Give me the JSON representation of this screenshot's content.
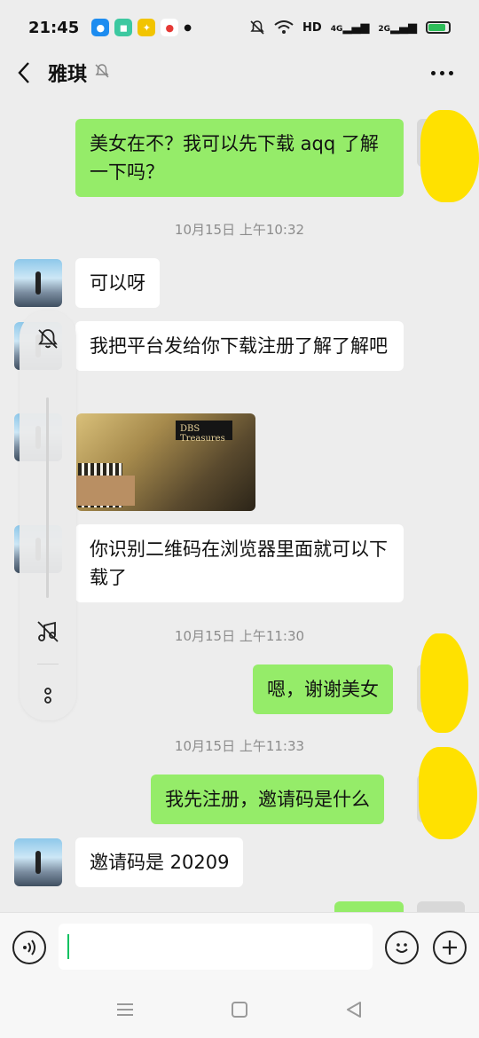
{
  "status_bar": {
    "time": "21:45",
    "network": "HD",
    "signal_1": "4G",
    "signal_2": "2G",
    "icons": [
      "qq-icon",
      "app-icon",
      "fuel-icon",
      "map-pin-icon",
      "dot-icon",
      "mute-icon",
      "wifi-icon",
      "battery-icon"
    ]
  },
  "header": {
    "title": "雅琪",
    "back_icon": "chevron-left-icon",
    "mute_icon": "bell-off-icon",
    "more_icon": "more-dots-icon"
  },
  "messages": [
    {
      "sender": "me",
      "text": "美女在不？我可以先下载 aqq 了解一下吗？"
    },
    {
      "type": "time",
      "text": "10月15日 上午10:32"
    },
    {
      "sender": "them",
      "text": "可以呀"
    },
    {
      "sender": "them",
      "text": "我把平台发给你下载注册了解了解吧"
    },
    {
      "sender": "them",
      "type": "image",
      "logo_text": "DBS Treasures"
    },
    {
      "sender": "them",
      "text": "你识别二维码在浏览器里面就可以下载了"
    },
    {
      "type": "time",
      "text": "10月15日 上午11:30"
    },
    {
      "sender": "me",
      "text": "嗯，谢谢美女"
    },
    {
      "type": "time",
      "text": "10月15日 上午11:33"
    },
    {
      "sender": "me",
      "text": "我先注册，邀请码是什么"
    },
    {
      "sender": "them",
      "text": "邀请码是 20209"
    }
  ],
  "side_panel": {
    "icons": [
      "bell-off-icon",
      "music-off-icon",
      "more-vertical-icon"
    ]
  },
  "input_bar": {
    "value": "",
    "voice_icon": "voice-icon",
    "emoji_icon": "emoji-icon",
    "plus_icon": "plus-icon"
  },
  "nav_bar": {
    "icons": [
      "menu-icon",
      "home-square-icon",
      "back-triangle-icon"
    ]
  },
  "colors": {
    "background": "#ededed",
    "my_bubble": "#95ec69",
    "their_bubble": "#ffffff",
    "accent": "#07c160",
    "timestamp": "#8c8c8c"
  }
}
